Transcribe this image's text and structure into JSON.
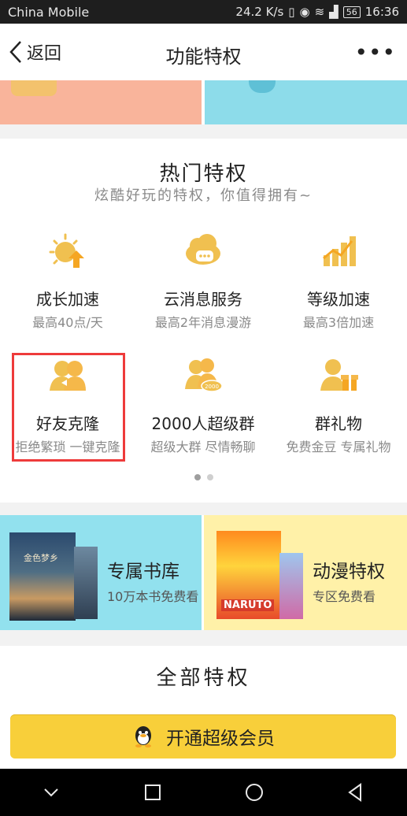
{
  "status_bar": {
    "carrier": "China Mobile",
    "speed": "24.2 K/s",
    "battery": "56",
    "time": "16:36"
  },
  "header": {
    "back_label": "返回",
    "title": "功能特权"
  },
  "hot": {
    "title": "热门特权",
    "subtitle": "炫酷好玩的特权，你值得拥有~",
    "items": [
      {
        "name": "成长加速",
        "desc": "最高40点/天",
        "icon": "growth-sun-icon"
      },
      {
        "name": "云消息服务",
        "desc": "最高2年消息漫游",
        "icon": "cloud-message-icon"
      },
      {
        "name": "等级加速",
        "desc": "最高3倍加速",
        "icon": "level-up-chart-icon"
      },
      {
        "name": "好友克隆",
        "desc": "拒绝繁琐 一键克隆",
        "icon": "friend-clone-icon"
      },
      {
        "name": "2000人超级群",
        "desc": "超级大群 尽情畅聊",
        "icon": "super-group-icon"
      },
      {
        "name": "群礼物",
        "desc": "免费金豆 专属礼物",
        "icon": "group-gift-icon"
      }
    ]
  },
  "features": [
    {
      "name": "专属书库",
      "desc": "10万本书免费看",
      "cover_text": "金色梦乡"
    },
    {
      "name": "动漫特权",
      "desc": "专区免费看",
      "cover_text": "NARUTO"
    }
  ],
  "all": {
    "title": "全部特权",
    "vip_button": "开通超级会员"
  },
  "colors": {
    "accent_gold": "#f0c050",
    "vip_button": "#f8cf3a",
    "highlight_red": "#ee3b3b"
  }
}
